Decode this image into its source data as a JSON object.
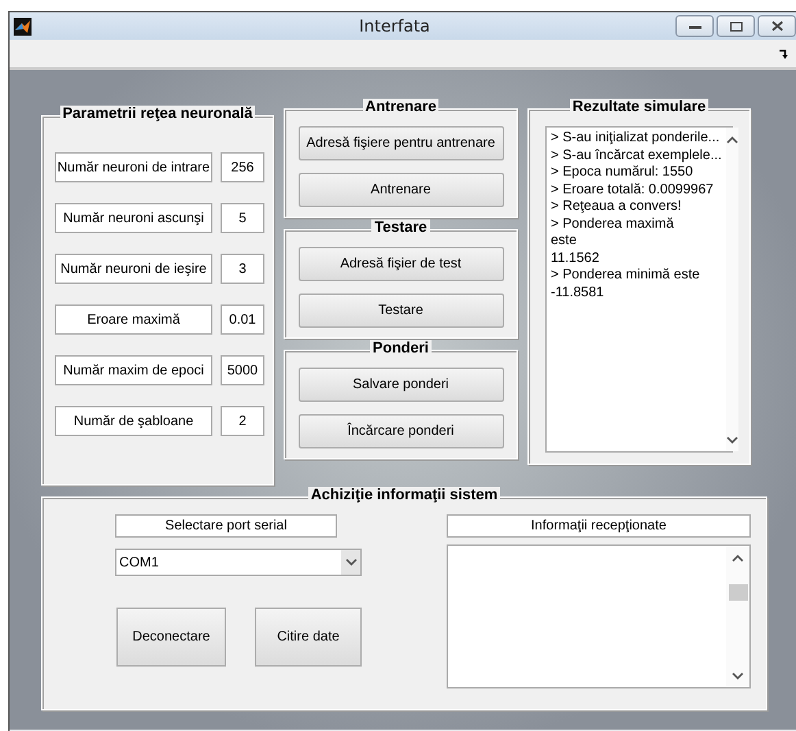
{
  "window": {
    "title": "Interfata"
  },
  "network_panel": {
    "title": "Parametrii reţea neuronală",
    "params": [
      {
        "label": "Număr neuroni de intrare",
        "value": "256"
      },
      {
        "label": "Număr neuroni ascunşi",
        "value": "5"
      },
      {
        "label": "Număr neuroni de ieşire",
        "value": "3"
      },
      {
        "label": "Eroare maximă",
        "value": "0.01"
      },
      {
        "label": "Număr maxim de epoci",
        "value": "5000"
      },
      {
        "label": "Număr de şabloane",
        "value": "2"
      }
    ]
  },
  "training_panel": {
    "title": "Antrenare",
    "buttons": [
      "Adresă fişiere pentru antrenare",
      "Antrenare"
    ]
  },
  "testing_panel": {
    "title": "Testare",
    "buttons": [
      "Adresă fişier de test",
      "Testare"
    ]
  },
  "weights_panel": {
    "title": "Ponderi",
    "buttons": [
      "Salvare ponderi",
      "Încărcare ponderi"
    ]
  },
  "results_panel": {
    "title": "Rezultate simulare",
    "lines": [
      "> S-au iniţializat ponderile...",
      "> S-au încărcat exemplele...",
      "> Epoca numărul: 1550",
      "> Eroare totală: 0.0099967",
      "> Reţeaua a convers!",
      "> Ponderea maximă",
      "este",
      "11.1562",
      "> Ponderea minimă este",
      "-11.8581"
    ]
  },
  "acquisition_panel": {
    "title": "Achiziţie informaţii sistem",
    "port_label": "Selectare port serial",
    "port_select": {
      "value": "COM1"
    },
    "buttons": [
      "Deconectare",
      "Citire date"
    ],
    "received_label": "Informaţii recepţionate"
  }
}
